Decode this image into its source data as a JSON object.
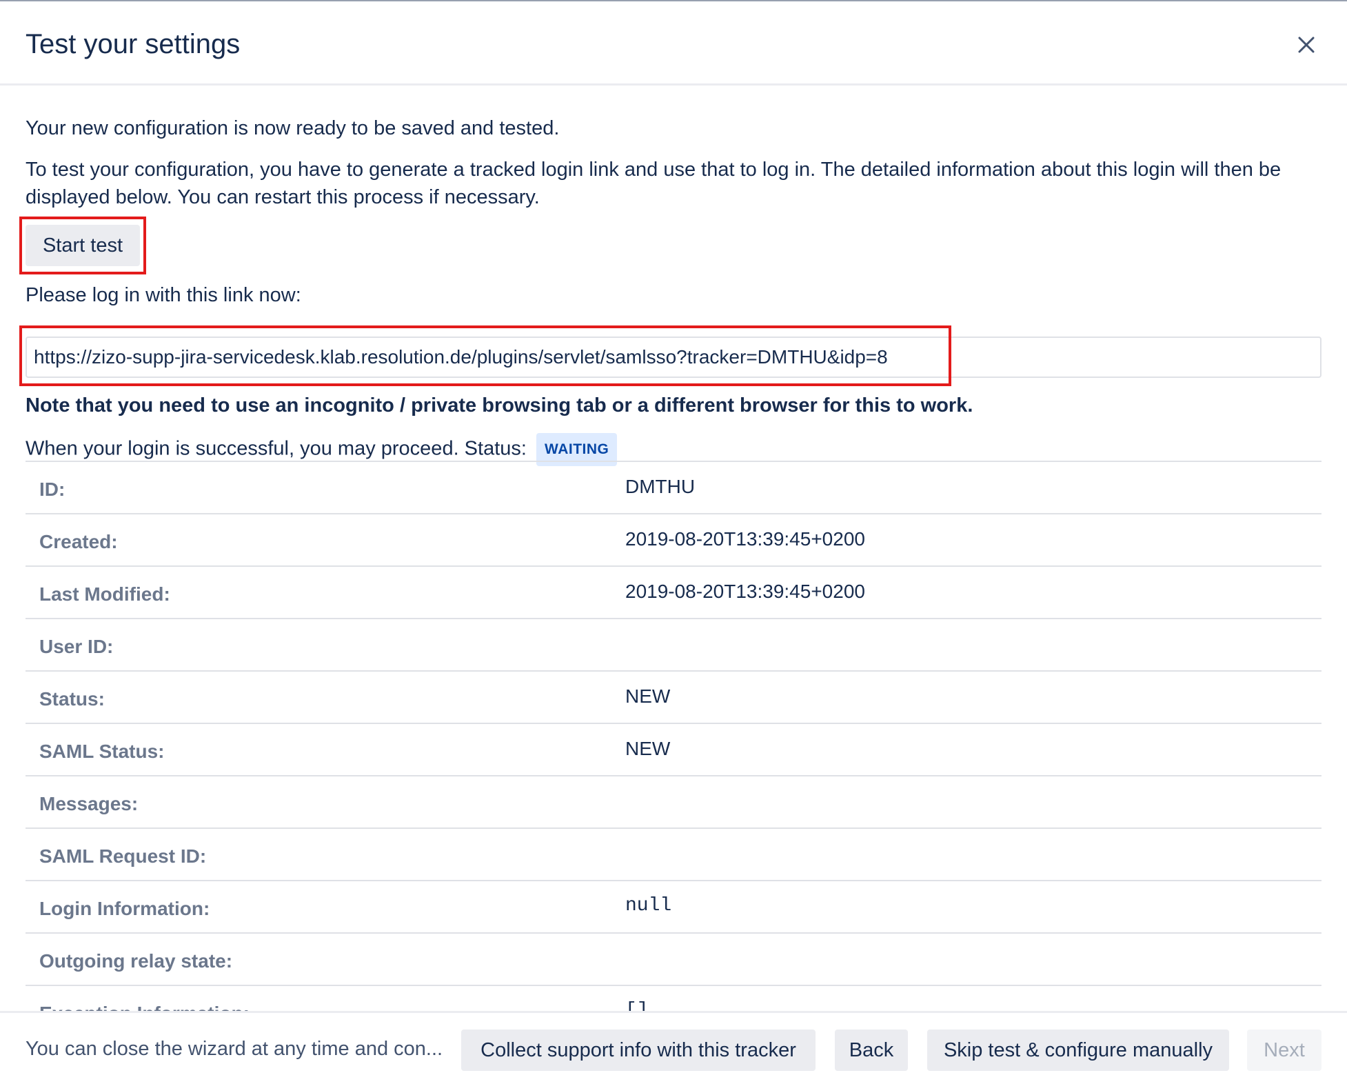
{
  "dialog": {
    "title": "Test your settings",
    "close_icon": "close-icon"
  },
  "content": {
    "intro": "Your new configuration is now ready to be saved and tested.",
    "instructions": "To test your configuration, you have to generate a tracked login link and use that to log in. The detailed information about this login will then be displayed below. You can restart this process if necessary.",
    "start_button": "Start test",
    "login_prompt": "Please log in with this link now:",
    "login_link": "https://zizo-supp-jira-servicedesk.klab.resolution.de/plugins/servlet/samlsso?tracker=DMTHU&idp=8",
    "note": "Note that you need to use an incognito / private browsing tab or a different browser for this to work.",
    "status_text": "When your login is successful, you may proceed. Status:",
    "status_badge": "WAITING",
    "highlight_color": "#e31b1b"
  },
  "details": [
    {
      "label": "ID:",
      "value": "DMTHU",
      "mono": false
    },
    {
      "label": "Created:",
      "value": "2019-08-20T13:39:45+0200",
      "mono": false
    },
    {
      "label": "Last Modified:",
      "value": "2019-08-20T13:39:45+0200",
      "mono": false
    },
    {
      "label": "User ID:",
      "value": "",
      "mono": false
    },
    {
      "label": "Status:",
      "value": "NEW",
      "mono": false
    },
    {
      "label": "SAML Status:",
      "value": "NEW",
      "mono": false
    },
    {
      "label": "Messages:",
      "value": "",
      "mono": false
    },
    {
      "label": "SAML Request ID:",
      "value": "",
      "mono": false
    },
    {
      "label": "Login Information:",
      "value": "null",
      "mono": true
    },
    {
      "label": "Outgoing relay state:",
      "value": "",
      "mono": false
    },
    {
      "label": "Exception Information:",
      "value": "[]",
      "mono": true
    }
  ],
  "footer": {
    "note": "You can close the wizard at any time and con...",
    "collect_button": "Collect support info with this tracker",
    "back_button": "Back",
    "skip_button": "Skip test & configure manually",
    "next_button": "Next"
  }
}
